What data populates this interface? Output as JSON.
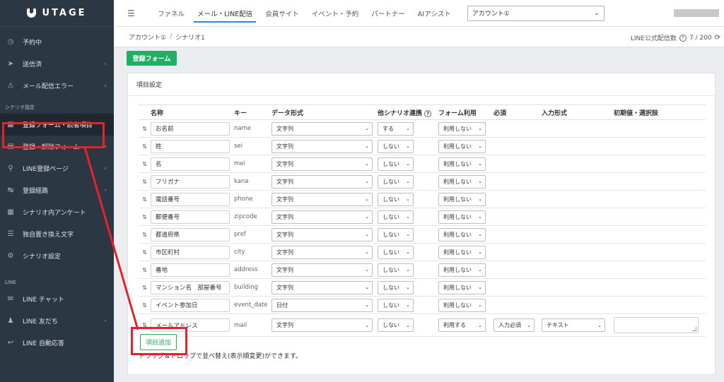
{
  "brand": {
    "name": "UTAGE"
  },
  "sidebar": {
    "items_top": [
      {
        "label": "予約中",
        "icon": "clock-icon",
        "chevron": false
      },
      {
        "label": "送信済",
        "icon": "send-icon",
        "chevron": true
      },
      {
        "label": "メール配信エラー",
        "icon": "warning-icon",
        "chevron": true
      }
    ],
    "section_scenario": "シナリオ設定",
    "items_scenario": [
      {
        "label": "登録フォーム・読者項目",
        "icon": "table-icon",
        "chevron": false,
        "active": true
      },
      {
        "label": "登録・解除フォーム",
        "icon": "form-icon",
        "chevron": true
      },
      {
        "label": "LINE登録ページ",
        "icon": "search-icon",
        "chevron": true
      },
      {
        "label": "登録経路",
        "icon": "route-icon",
        "chevron": true
      },
      {
        "label": "シナリオ内アンケート",
        "icon": "table-icon",
        "chevron": false
      },
      {
        "label": "独自置き換え文字",
        "icon": "list-icon",
        "chevron": false
      },
      {
        "label": "シナリオ設定",
        "icon": "gear-icon",
        "chevron": false
      }
    ],
    "section_line": "LINE",
    "items_line": [
      {
        "label": "LINE チャット",
        "icon": "chat-icon",
        "chevron": false
      },
      {
        "label": "LINE 友だち",
        "icon": "user-icon",
        "chevron": true
      },
      {
        "label": "LINE 自動応答",
        "icon": "reply-icon",
        "chevron": false
      }
    ]
  },
  "topbar": {
    "tabs": [
      "ファネル",
      "メール・LINE配信",
      "会員サイト",
      "イベント・予約",
      "パートナー",
      "AIアシスト"
    ],
    "active_tab": 1,
    "account_select": "アカウント①"
  },
  "breadcrumb": {
    "account": "アカウント①",
    "separator": "/",
    "scenario": "シナリオ1"
  },
  "line_count": {
    "label": "LINE公式配信数",
    "value": "7 / 200"
  },
  "register_form_button": "登録フォーム",
  "panel": {
    "title": "項目設定",
    "columns": [
      "名称",
      "キー",
      "データ形式",
      "他シナリオ連携",
      "フォーム利用",
      "必須",
      "入力形式",
      "初期値・選択肢"
    ],
    "rows": [
      {
        "name": "お名前",
        "key": "name",
        "type": "文字列",
        "other": "する",
        "form": "利用しない"
      },
      {
        "name": "姓",
        "key": "sei",
        "type": "文字列",
        "other": "しない",
        "form": "利用しない"
      },
      {
        "name": "名",
        "key": "mei",
        "type": "文字列",
        "other": "しない",
        "form": "利用しない"
      },
      {
        "name": "フリガナ",
        "key": "kana",
        "type": "文字列",
        "other": "しない",
        "form": "利用しない"
      },
      {
        "name": "電話番号",
        "key": "phone",
        "type": "文字列",
        "other": "しない",
        "form": "利用しない"
      },
      {
        "name": "郵便番号",
        "key": "zipcode",
        "type": "文字列",
        "other": "しない",
        "form": "利用しない"
      },
      {
        "name": "都道府県",
        "key": "pref",
        "type": "文字列",
        "other": "しない",
        "form": "利用しない"
      },
      {
        "name": "市区町村",
        "key": "city",
        "type": "文字列",
        "other": "しない",
        "form": "利用しない"
      },
      {
        "name": "番地",
        "key": "address",
        "type": "文字列",
        "other": "しない",
        "form": "利用しない"
      },
      {
        "name": "マンション名　部屋番号",
        "key": "building",
        "type": "文字列",
        "other": "しない",
        "form": "利用しない"
      },
      {
        "name": "イベント参加日",
        "key": "event_date",
        "type": "日付",
        "other": "しない",
        "form": "利用しない"
      },
      {
        "name": "メールアドレス",
        "key": "mail",
        "type": "文字列",
        "other": "しない",
        "form": "利用する",
        "required": "入力必須",
        "input": "テキスト",
        "initial": ""
      }
    ],
    "add_button": "項目追加",
    "hint": "ドラッグ＆ドロップで並べ替え(表示順変更)ができます。"
  },
  "colors": {
    "sidebar_bg": "#2b3844",
    "accent_green": "#1fb163",
    "annotation_red": "#e8222a",
    "active_tab_underline": "#1f8ceb"
  }
}
